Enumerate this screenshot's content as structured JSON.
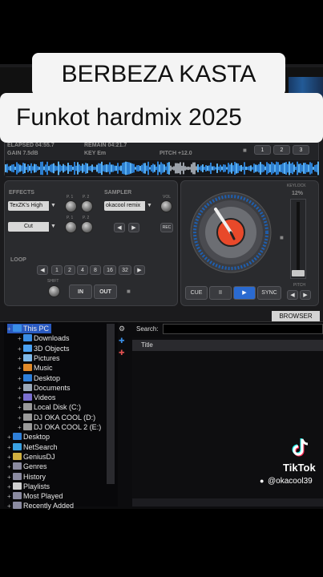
{
  "overlay": {
    "title_line1": "BERBEZA KASTA",
    "title_line2": "Funkot hardmix 2025"
  },
  "deck": {
    "elapsed": "ELAPSED 04:55.7",
    "remain": "REMAIN 04:21.7",
    "gain": "GAIN 7.5dB",
    "key": "KEY Em",
    "pitch": "PITCH +12.0",
    "hotcues": [
      "1",
      "2",
      "3"
    ],
    "effects_label": "EFFECTS",
    "effect_select": "TexZK's High",
    "effect_select2": "Cut",
    "p1": "P. 1",
    "p2": "P. 2",
    "sampler_label": "SAMPLER",
    "sampler_select": "okacool remix",
    "vol": "VOL",
    "rec": "REC",
    "loop_label": "LOOP",
    "loop_values": [
      "1",
      "2",
      "4",
      "8",
      "16",
      "32"
    ],
    "shift": "SHIFT",
    "in": "IN",
    "out": "OUT",
    "keylock": "KEYLOCK",
    "keylock_pct": "12%",
    "cue": "CUE",
    "pause": "II",
    "play": "▶",
    "sync": "SYNC",
    "pitch_label": "PITCH",
    "browser_tab": "BROWSER"
  },
  "browser": {
    "search_label": "Search:",
    "search_value": "",
    "column_title": "Title",
    "tree": [
      {
        "label": "This PC",
        "color": "#3a8ee6",
        "indent": 0,
        "selected": true
      },
      {
        "label": "Downloads",
        "color": "#3a8ee6",
        "indent": 1
      },
      {
        "label": "3D Objects",
        "color": "#4aa0f0",
        "indent": 1
      },
      {
        "label": "Pictures",
        "color": "#7fb8e8",
        "indent": 1
      },
      {
        "label": "Music",
        "color": "#e08a2a",
        "indent": 1
      },
      {
        "label": "Desktop",
        "color": "#2f7fd8",
        "indent": 1
      },
      {
        "label": "Documents",
        "color": "#9aa8b8",
        "indent": 1
      },
      {
        "label": "Videos",
        "color": "#7a6fd0",
        "indent": 1
      },
      {
        "label": "Local Disk (C:)",
        "color": "#9a9a9a",
        "indent": 1
      },
      {
        "label": "DJ OKA COOL (D:)",
        "color": "#9a9a9a",
        "indent": 1
      },
      {
        "label": "DJ OKA COOL 2 (E:)",
        "color": "#9a9a9a",
        "indent": 1
      },
      {
        "label": "Desktop",
        "color": "#2f7fd8",
        "indent": 0
      },
      {
        "label": "NetSearch",
        "color": "#3aa0e0",
        "indent": 0
      },
      {
        "label": "GeniusDJ",
        "color": "#d0b040",
        "indent": 0
      },
      {
        "label": "Genres",
        "color": "#8a8aa0",
        "indent": 0
      },
      {
        "label": "History",
        "color": "#8a8aa0",
        "indent": 0
      },
      {
        "label": "Playlists",
        "color": "#d0d0d0",
        "indent": 0
      },
      {
        "label": "Most Played",
        "color": "#8a8aa0",
        "indent": 0
      },
      {
        "label": "Recently Added",
        "color": "#8a8aa0",
        "indent": 0
      }
    ]
  },
  "tiktok": {
    "brand": "TikTok",
    "handle": "@okacool39"
  }
}
